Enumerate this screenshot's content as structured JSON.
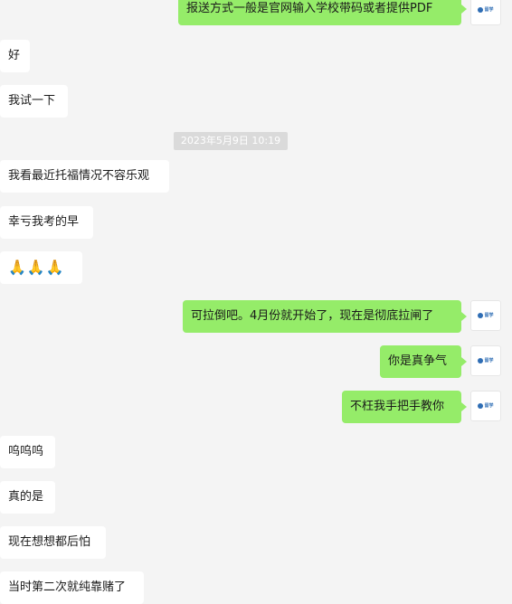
{
  "messages": {
    "top_partial": "报送方式一般是官网输入学校带码或者提供PDF",
    "m1": "好",
    "m2": "我试一下",
    "m4": "我看最近托福情况不容乐观",
    "m5": "幸亏我考的早",
    "m6": "🙏🙏🙏",
    "m7": "可拉倒吧。4月份就开始了，现在是彻底拉闸了",
    "m8": "你是真争气",
    "m9": "不枉我手把手教你",
    "m10": "呜呜呜",
    "m11": "真的是",
    "m12": "现在想想都后怕",
    "m13": "当时第二次就纯靠赌了"
  },
  "timestamp": "2023年5月9日 10:19",
  "avatar": {
    "icon": "brand-logo-icon"
  },
  "colors": {
    "background": "#f4f4f4",
    "incoming_bubble": "#ffffff",
    "outgoing_bubble": "#95ec69",
    "timestamp_bg": "#dadada"
  }
}
